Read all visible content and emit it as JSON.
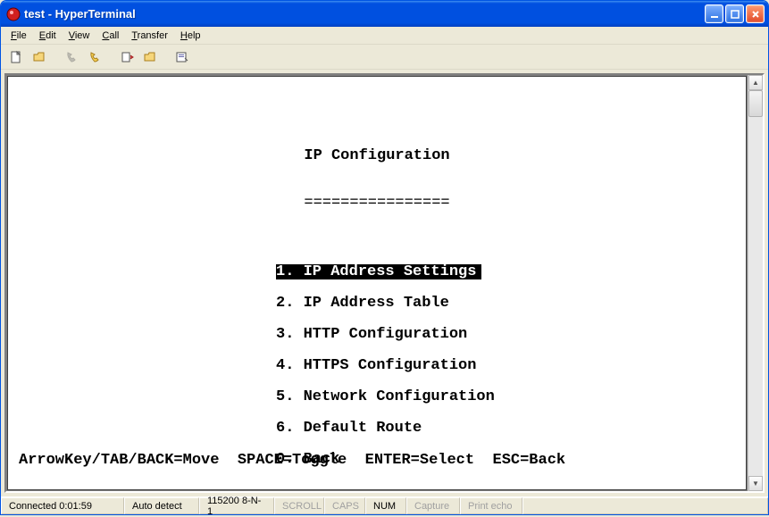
{
  "window": {
    "title": "test - HyperTerminal"
  },
  "menubar": {
    "file": "File",
    "edit": "Edit",
    "view": "View",
    "call": "Call",
    "transfer": "Transfer",
    "help": "Help"
  },
  "toolbar_icons": {
    "new": "new-file-icon",
    "open": "open-folder-icon",
    "connect": "phone-connect-icon",
    "disconnect": "phone-disconnect-icon",
    "send": "send-file-icon",
    "receive": "receive-file-icon",
    "properties": "properties-icon"
  },
  "terminal": {
    "heading": "IP Configuration",
    "underline": "================",
    "items": [
      {
        "num": "1",
        "label": "IP Address Settings",
        "selected": true
      },
      {
        "num": "2",
        "label": "IP Address Table",
        "selected": false
      },
      {
        "num": "3",
        "label": "HTTP Configuration",
        "selected": false
      },
      {
        "num": "4",
        "label": "HTTPS Configuration",
        "selected": false
      },
      {
        "num": "5",
        "label": "Network Configuration",
        "selected": false
      },
      {
        "num": "6",
        "label": "Default Route",
        "selected": false
      },
      {
        "num": "0",
        "label": "Back",
        "selected": false
      }
    ],
    "help": "ArrowKey/TAB/BACK=Move  SPACE=Toggle  ENTER=Select  ESC=Back"
  },
  "statusbar": {
    "connection": "Connected 0:01:59",
    "autodetect": "Auto detect",
    "port": "115200 8-N-1",
    "scroll": "SCROLL",
    "caps": "CAPS",
    "num": "NUM",
    "capture": "Capture",
    "printecho": "Print echo"
  }
}
